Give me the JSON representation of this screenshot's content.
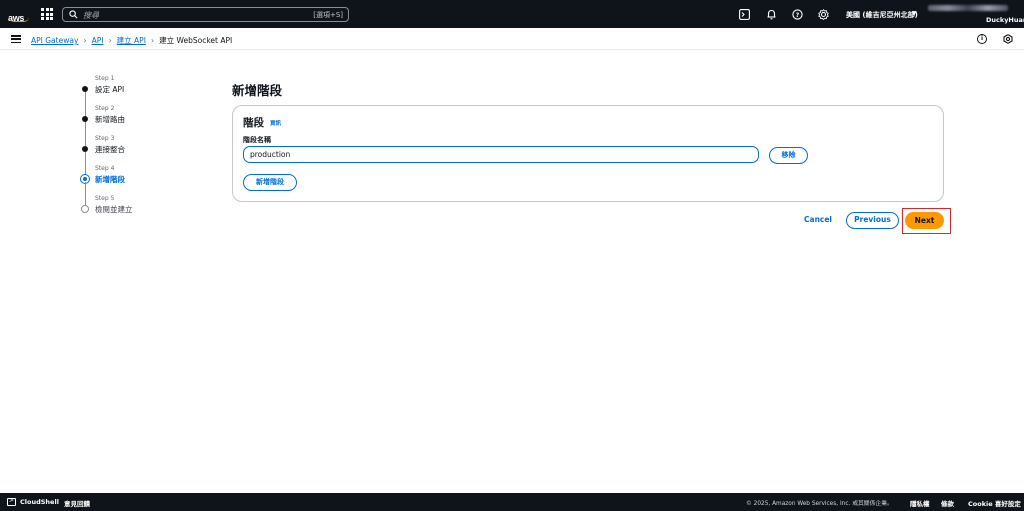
{
  "topbar": {
    "logo_text": "aws",
    "search_placeholder": "搜尋",
    "search_shortcut": "[選項+S]",
    "region": "美國 (維吉尼亞州北部)",
    "username": "DuckyHuang"
  },
  "breadcrumb": {
    "items": [
      "API Gateway",
      "API",
      "建立 API"
    ],
    "current": "建立 WebSocket API"
  },
  "steps": [
    {
      "num": "Step 1",
      "label": "設定 API",
      "state": "done"
    },
    {
      "num": "Step 2",
      "label": "新增路由",
      "state": "done"
    },
    {
      "num": "Step 3",
      "label": "連接整合",
      "state": "done"
    },
    {
      "num": "Step 4",
      "label": "新增階段",
      "state": "active"
    },
    {
      "num": "Step 5",
      "label": "檢閱並建立",
      "state": "pending"
    }
  ],
  "main": {
    "title": "新增階段",
    "container_title": "階段",
    "info_link": "資訊",
    "field_label": "階段名稱",
    "stage_name_value": "production",
    "remove_label": "移除",
    "add_stage_label": "新增階段"
  },
  "actions": {
    "cancel": "Cancel",
    "previous": "Previous",
    "next": "Next"
  },
  "footer": {
    "cloudshell": "CloudShell",
    "feedback": "意見回饋",
    "copyright": "© 2025, Amazon Web Services, Inc. 或其關係企業。",
    "privacy": "隱私權",
    "terms": "條款",
    "cookie": "Cookie 喜好設定"
  },
  "colors": {
    "nav_bg": "#0f141a",
    "link": "#006ce0",
    "primary_button": "#ff9900",
    "highlight": "#e0242e"
  }
}
